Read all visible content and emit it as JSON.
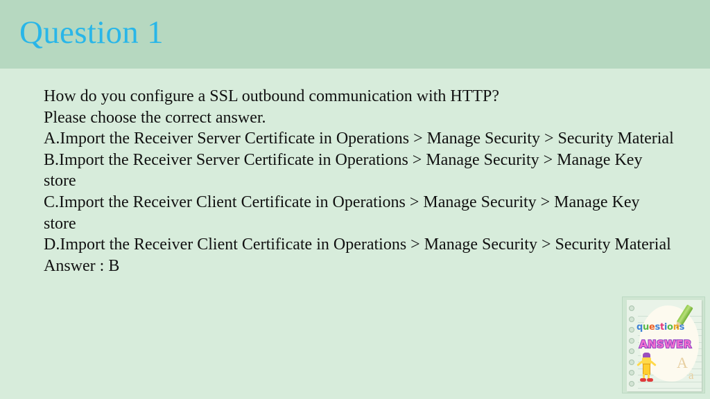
{
  "slide": {
    "title": "Question 1",
    "title_color": "#29b6e8",
    "header_bg": "#b6d8c0",
    "body_bg": "#d7ecdb",
    "body_text_color": "#111111"
  },
  "content": {
    "question": "How do you configure a SSL outbound communication with HTTP?",
    "instruction": "Please choose the correct answer.",
    "options": [
      "A.Import the Receiver Server Certificate in Operations > Manage Security > Security Material",
      "B.Import the Receiver Server Certificate in Operations > Manage Security > Manage Key store",
      "C.Import the Receiver Client Certificate in Operations > Manage Security > Manage Key store",
      "D.Import the Receiver Client Certificate in Operations > Manage Security > Security Material"
    ],
    "answer_line": "Answer : B"
  },
  "clipart": {
    "questions_word": "questions",
    "questions_letters": [
      {
        "ch": "q",
        "color": "#3f82d6"
      },
      {
        "ch": "u",
        "color": "#59b94a"
      },
      {
        "ch": "e",
        "color": "#e8622a"
      },
      {
        "ch": "s",
        "color": "#3f82d6"
      },
      {
        "ch": "t",
        "color": "#e03a7a"
      },
      {
        "ch": "i",
        "color": "#3f82d6"
      },
      {
        "ch": "o",
        "color": "#59b94a"
      },
      {
        "ch": "n",
        "color": "#e8a524"
      },
      {
        "ch": "s",
        "color": "#3f82d6"
      }
    ],
    "answer_word": "ANSWER",
    "answer_fill": "#f06fd0",
    "answer_outline": "#8c3fc4",
    "big_letter": "A",
    "small_letter": "a",
    "pencil_color": "#8fc94a"
  }
}
